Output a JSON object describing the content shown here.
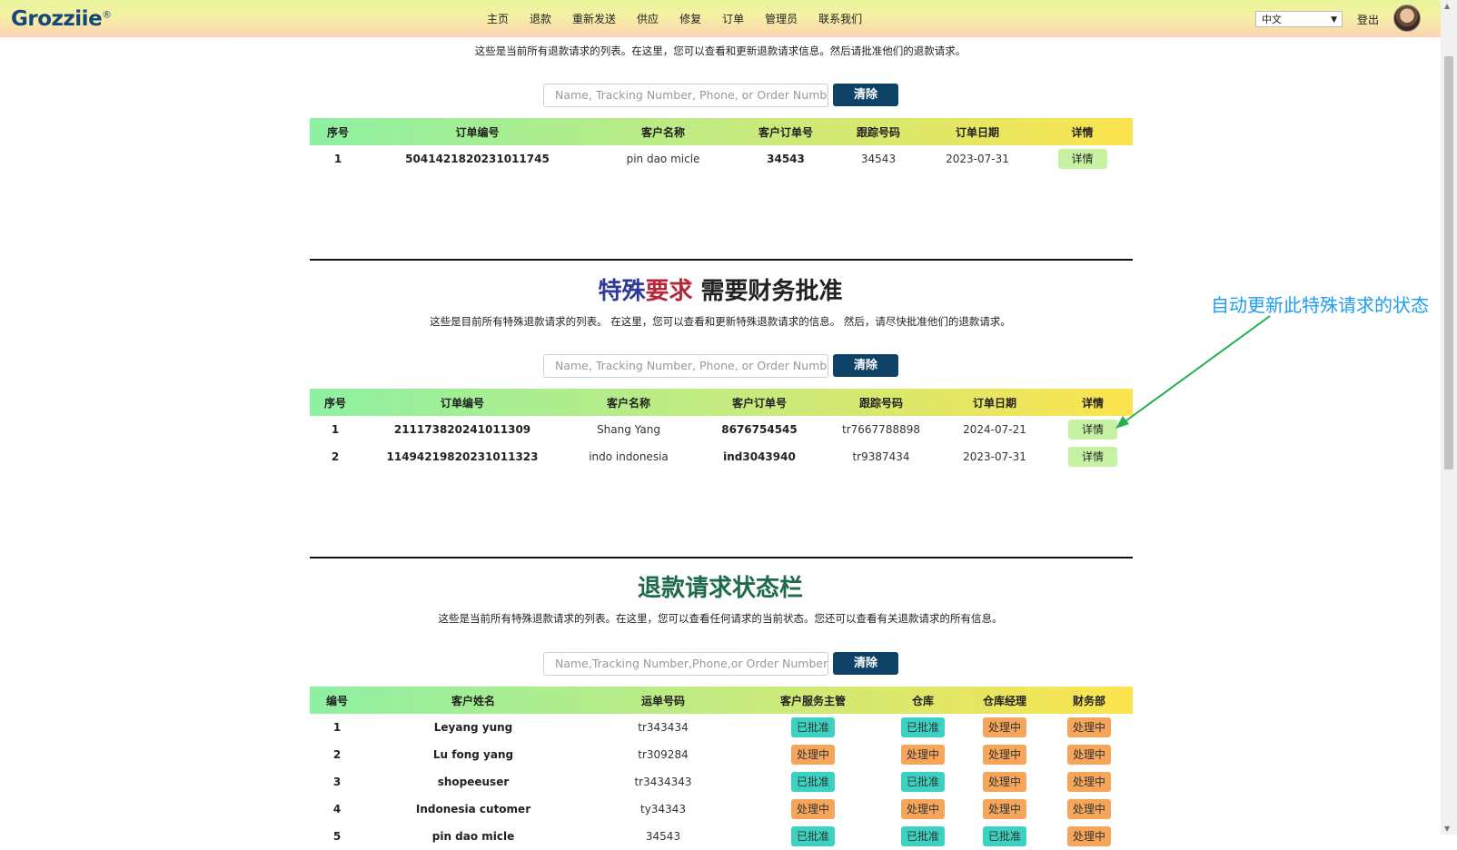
{
  "nav": {
    "logo": "Grozziie",
    "logo_mark": "®",
    "menu": [
      "主页",
      "退款",
      "重新发送",
      "供应",
      "修复",
      "订单",
      "管理员",
      "联系我们"
    ],
    "language": "中文",
    "logout": "登出"
  },
  "refund_list": {
    "description": "这些是当前所有退款请求的列表。在这里，您可以查看和更新退款请求信息。然后请批准他们的退款请求。",
    "search_placeholder": "Name, Tracking Number, Phone, or Order Number",
    "clear_label": "清除",
    "columns": [
      "序号",
      "订单编号",
      "客户名称",
      "客户订单号",
      "跟踪号码",
      "订单日期",
      "详情"
    ],
    "rows": [
      {
        "no": "1",
        "order": "5041421820231011745",
        "customer": "pin dao micle",
        "cust_order": "34543",
        "tracking": "34543",
        "date": "2023-07-31",
        "detail": "详情"
      }
    ]
  },
  "special": {
    "title_part1": "特殊",
    "title_part2": "要求",
    "title_part3": " 需要财务批准",
    "description": "这些是目前所有特殊退款请求的列表。 在这里，您可以查看和更新特殊退款请求的信息。 然后，请尽快批准他们的退款请求。",
    "search_placeholder": "Name, Tracking Number, Phone, or Order Number",
    "clear_label": "清除",
    "columns": [
      "序号",
      "订单编号",
      "客户名称",
      "客户订单号",
      "跟踪号码",
      "订单日期",
      "详情"
    ],
    "rows": [
      {
        "no": "1",
        "order": "211173820241011309",
        "customer": "Shang Yang",
        "cust_order": "8676754545",
        "tracking": "tr7667788898",
        "date": "2024-07-21",
        "detail": "详情"
      },
      {
        "no": "2",
        "order": "11494219820231011323",
        "customer": "indo indonesia",
        "cust_order": "ind3043940",
        "tracking": "tr9387434",
        "date": "2023-07-31",
        "detail": "详情"
      }
    ]
  },
  "status": {
    "title": "退款请求状态栏",
    "description": "这些是当前所有特殊退款请求的列表。在这里，您可以查看任何请求的当前状态。您还可以查看有关退款请求的所有信息。",
    "search_placeholder": "Name,Tracking Number,Phone,or Order Number",
    "clear_label": "清除",
    "columns": [
      "编号",
      "客户姓名",
      "运单号码",
      "客户服务主管",
      "仓库",
      "仓库经理",
      "财务部"
    ],
    "rows": [
      {
        "no": "1",
        "name": "Leyang yung",
        "waybill": "tr343434",
        "cs": "已批准",
        "wh": "已批准",
        "whm": "处理中",
        "fin": "处理中"
      },
      {
        "no": "2",
        "name": "Lu fong yang",
        "waybill": "tr309284",
        "cs": "处理中",
        "wh": "处理中",
        "whm": "处理中",
        "fin": "处理中"
      },
      {
        "no": "3",
        "name": "shopeeuser",
        "waybill": "tr3434343",
        "cs": "已批准",
        "wh": "已批准",
        "whm": "处理中",
        "fin": "处理中"
      },
      {
        "no": "4",
        "name": "Indonesia cutomer",
        "waybill": "ty34343",
        "cs": "处理中",
        "wh": "处理中",
        "whm": "处理中",
        "fin": "处理中"
      },
      {
        "no": "5",
        "name": "pin dao micle",
        "waybill": "34543",
        "cs": "已批准",
        "wh": "已批准",
        "whm": "已批准",
        "fin": "处理中"
      }
    ]
  },
  "annotation": {
    "text": "自动更新此特殊请求的状态"
  },
  "colors": {
    "approved": "#3cd2c1",
    "pending": "#f6a65a",
    "title_blue": "#2f3a9a",
    "title_red": "#b5283a",
    "title_green": "#1e6b4c",
    "arrow_green": "#22b14c",
    "annotation_blue": "#1e9df0",
    "button_navy": "#0d4166"
  }
}
